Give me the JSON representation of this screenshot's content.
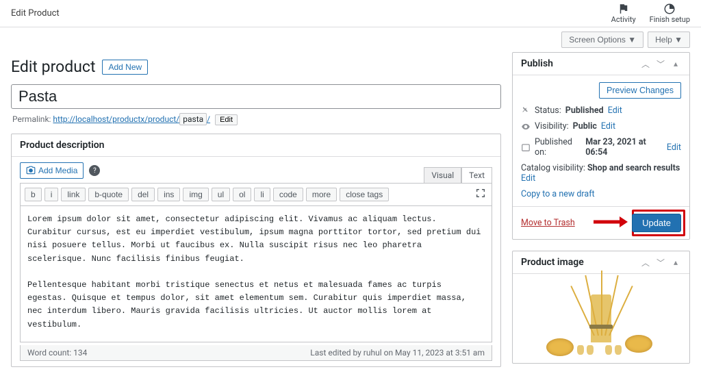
{
  "topbar": {
    "title": "Edit Product",
    "activity": "Activity",
    "finish": "Finish setup"
  },
  "helpbar": {
    "screen_options": "Screen Options ▼",
    "help": "Help ▼"
  },
  "page": {
    "heading": "Edit product",
    "add_new": "Add New",
    "title_value": "Pasta",
    "permalink_label": "Permalink:",
    "permalink_base": "http://localhost/productx/product/",
    "permalink_slug": "pasta",
    "permalink_trail": "/",
    "permalink_edit": "Edit"
  },
  "desc_box": {
    "title": "Product description",
    "add_media": "Add Media",
    "tabs": {
      "visual": "Visual",
      "text": "Text"
    },
    "qt": [
      "b",
      "i",
      "link",
      "b-quote",
      "del",
      "ins",
      "img",
      "ul",
      "ol",
      "li",
      "code",
      "more",
      "close tags"
    ],
    "content": "Lorem ipsum dolor sit amet, consectetur adipiscing elit. Vivamus ac aliquam lectus. Curabitur cursus, est eu imperdiet vestibulum, ipsum magna porttitor tortor, sed pretium dui nisi posuere tellus. Morbi ut faucibus ex. Nulla suscipit risus nec leo pharetra scelerisque. Nunc facilisis finibus feugiat.\n\nPellentesque habitant morbi tristique senectus et netus et malesuada fames ac turpis egestas. Quisque et tempus dolor, sit amet elementum sem. Curabitur quis imperdiet massa, nec interdum libero. Mauris gravida facilisis ultricies. Ut auctor mollis lorem at vestibulum.\n\nInteger neque dolor, ultrices non purus a, maximus malesuada odio. Etiam pharetra lacus eu arcu commodo dictum. Phasellus eleifend erat quis hendrerit dictum. Donec feugiat in arcu nec dictum. Sed bibendum venenatis arcu id posuere. Suspendisse ac tempus massa, id congue justo. Nunc neque eget orci vehicula sollicitudin. Curabitur ac pharetra neque.",
    "word_count": "Word count: 134",
    "last_edit": "Last edited by ruhul on May 11, 2023 at 3:51 am"
  },
  "publish": {
    "title": "Publish",
    "preview": "Preview Changes",
    "status_label": "Status:",
    "status_value": "Published",
    "visibility_label": "Visibility:",
    "visibility_value": "Public",
    "published_on_label": "Published on:",
    "published_on_value": "Mar 23, 2021 at 06:54",
    "catalog_label": "Catalog visibility:",
    "catalog_value": "Shop and search results",
    "edit": "Edit",
    "copy": "Copy to a new draft",
    "trash": "Move to Trash",
    "update": "Update"
  },
  "product_image": {
    "title": "Product image"
  }
}
